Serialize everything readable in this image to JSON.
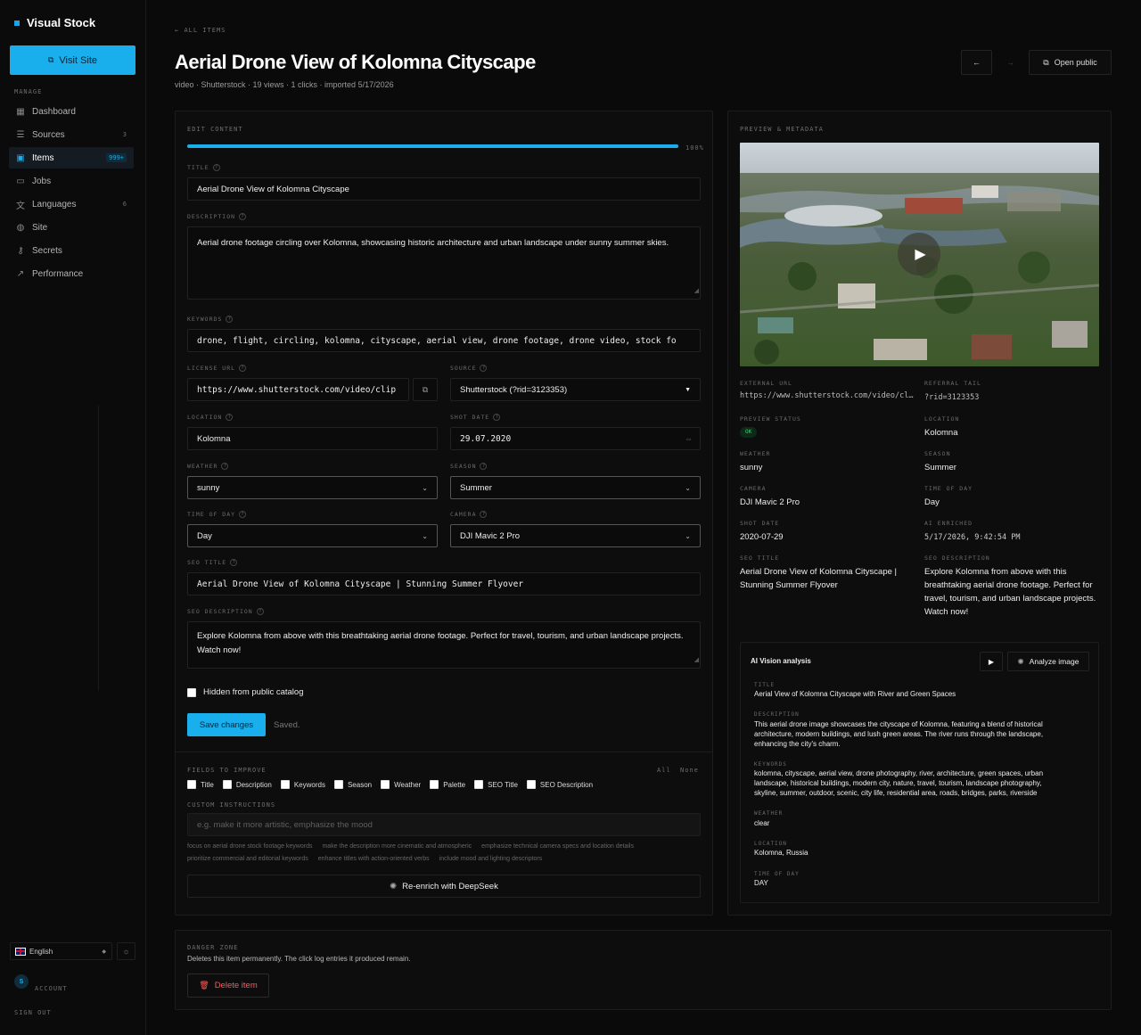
{
  "sidebar": {
    "brand": "Visual Stock",
    "visit_label": "Visit Site",
    "section_label": "MANAGE",
    "items": [
      {
        "label": "Dashboard",
        "icon": "grid-icon",
        "count": ""
      },
      {
        "label": "Sources",
        "icon": "database-icon",
        "count": "3"
      },
      {
        "label": "Items",
        "icon": "play-square-icon",
        "count": "999+"
      },
      {
        "label": "Jobs",
        "icon": "briefcase-icon",
        "count": ""
      },
      {
        "label": "Languages",
        "icon": "translate-icon",
        "count": "6"
      },
      {
        "label": "Site",
        "icon": "globe-icon",
        "count": ""
      },
      {
        "label": "Secrets",
        "icon": "key-icon",
        "count": ""
      },
      {
        "label": "Performance",
        "icon": "trend-icon",
        "count": ""
      }
    ],
    "language": "English",
    "avatar_initial": "S",
    "account_label": "ACCOUNT",
    "signout_label": "SIGN OUT"
  },
  "header": {
    "back_label": "ALL ITEMS",
    "title": "Aerial Drone View of Kolomna Cityscape",
    "subline": "video · Shutterstock · 19 views · 1 clicks · imported 5/17/2026",
    "open_public_label": "Open public"
  },
  "edit": {
    "section_label": "EDIT CONTENT",
    "progress": 100,
    "progress_label": "100%",
    "title_label": "TITLE",
    "title_value": "Aerial Drone View of Kolomna Cityscape",
    "description_label": "DESCRIPTION",
    "description_value": "Aerial drone footage circling over Kolomna, showcasing historic architecture and urban landscape under sunny summer skies.",
    "keywords_label": "KEYWORDS",
    "keywords_value": "drone, flight, circling, kolomna, cityscape, aerial view, drone footage, drone video, stock fo",
    "license_label": "LICENSE URL",
    "license_value": "https://www.shutterstock.com/video/clip",
    "source_label": "SOURCE",
    "source_value": "Shutterstock (?rid=3123353)",
    "location_label": "LOCATION",
    "location_value": "Kolomna",
    "shot_date_label": "SHOT DATE",
    "shot_date_value": "29.07.2020",
    "weather_label": "WEATHER",
    "weather_value": "sunny",
    "season_label": "SEASON",
    "season_value": "Summer",
    "time_label": "TIME OF DAY",
    "time_value": "Day",
    "camera_label": "CAMERA",
    "camera_value": "DJI Mavic 2 Pro",
    "seo_title_label": "SEO TITLE",
    "seo_title_value": "Aerial Drone View of Kolomna Cityscape | Stunning Summer Flyover",
    "seo_desc_label": "SEO DESCRIPTION",
    "seo_desc_value": "Explore Kolomna from above with this breathtaking aerial drone footage. Perfect for travel, tourism, and urban landscape projects. Watch now!",
    "hidden_label": "Hidden from public catalog",
    "save_label": "Save changes",
    "saved_label": "Saved.",
    "fields_label": "FIELDS TO IMPROVE",
    "all_label": "All",
    "none_label": "None",
    "fields": [
      "Title",
      "Description",
      "Keywords",
      "Season",
      "Weather",
      "Palette",
      "SEO Title",
      "SEO Description"
    ],
    "custom_label": "CUSTOM INSTRUCTIONS",
    "custom_placeholder": "e.g. make it more artistic, emphasize the mood",
    "suggestions_row1": [
      "focus on aerial drone stock footage keywords",
      "make the description more cinematic and atmospheric",
      "emphasize technical camera specs and location details"
    ],
    "suggestions_row2": [
      "prioritize commercial and editorial keywords",
      "enhance titles with action-oriented verbs",
      "include mood and lighting descriptors"
    ],
    "reenrich_label": "Re-enrich with DeepSeek"
  },
  "preview": {
    "section_label": "PREVIEW & METADATA",
    "external_url_label": "EXTERNAL URL",
    "external_url_value": "https://www.shutterstock.com/video/cl…",
    "referral_label": "REFERRAL TAIL",
    "referral_value": "?rid=3123353",
    "status_label": "PREVIEW STATUS",
    "status_value": "OK",
    "location_label": "LOCATION",
    "location_value": "Kolomna",
    "weather_label": "WEATHER",
    "weather_value": "sunny",
    "season_label": "SEASON",
    "season_value": "Summer",
    "camera_label": "CAMERA",
    "camera_value": "DJI Mavic 2 Pro",
    "time_label": "TIME OF DAY",
    "time_value": "Day",
    "shot_date_label": "SHOT DATE",
    "shot_date_value": "2020-07-29",
    "ai_enriched_label": "AI ENRICHED",
    "ai_enriched_value": "5/17/2026, 9:42:54 PM",
    "seo_title_label": "SEO TITLE",
    "seo_title_value": "Aerial Drone View of Kolomna Cityscape | Stunning Summer Flyover",
    "seo_desc_label": "SEO DESCRIPTION",
    "seo_desc_value": "Explore Kolomna from above with this breathtaking aerial drone footage. Perfect for travel, tourism, and urban landscape projects. Watch now!"
  },
  "ai": {
    "heading": "AI Vision analysis",
    "analyze_label": "Analyze image",
    "title_label": "TITLE",
    "title_value": "Aerial View of Kolomna Cityscape with River and Green Spaces",
    "description_label": "DESCRIPTION",
    "description_value": "This aerial drone image showcases the cityscape of Kolomna, featuring a blend of historical architecture, modern buildings, and lush green areas. The river runs through the landscape, enhancing the city's charm.",
    "keywords_label": "KEYWORDS",
    "keywords_value": "kolomna, cityscape, aerial view, drone photography, river, architecture, green spaces, urban landscape, historical buildings, modern city, nature, travel, tourism, landscape photography, skyline, summer, outdoor, scenic, city life, residential area, roads, bridges, parks, riverside",
    "weather_label": "WEATHER",
    "weather_value": "clear",
    "location_label": "LOCATION",
    "location_value": "Kolomna, Russia",
    "time_label": "TIME OF DAY",
    "time_value": "DAY"
  },
  "danger": {
    "label": "DANGER ZONE",
    "text": "Deletes this item permanently. The click log entries it produced remain.",
    "delete_label": "Delete item"
  },
  "colors": {
    "accent": "#19aeec",
    "danger": "#ff5a5a",
    "ok": "#3ecf6e"
  }
}
